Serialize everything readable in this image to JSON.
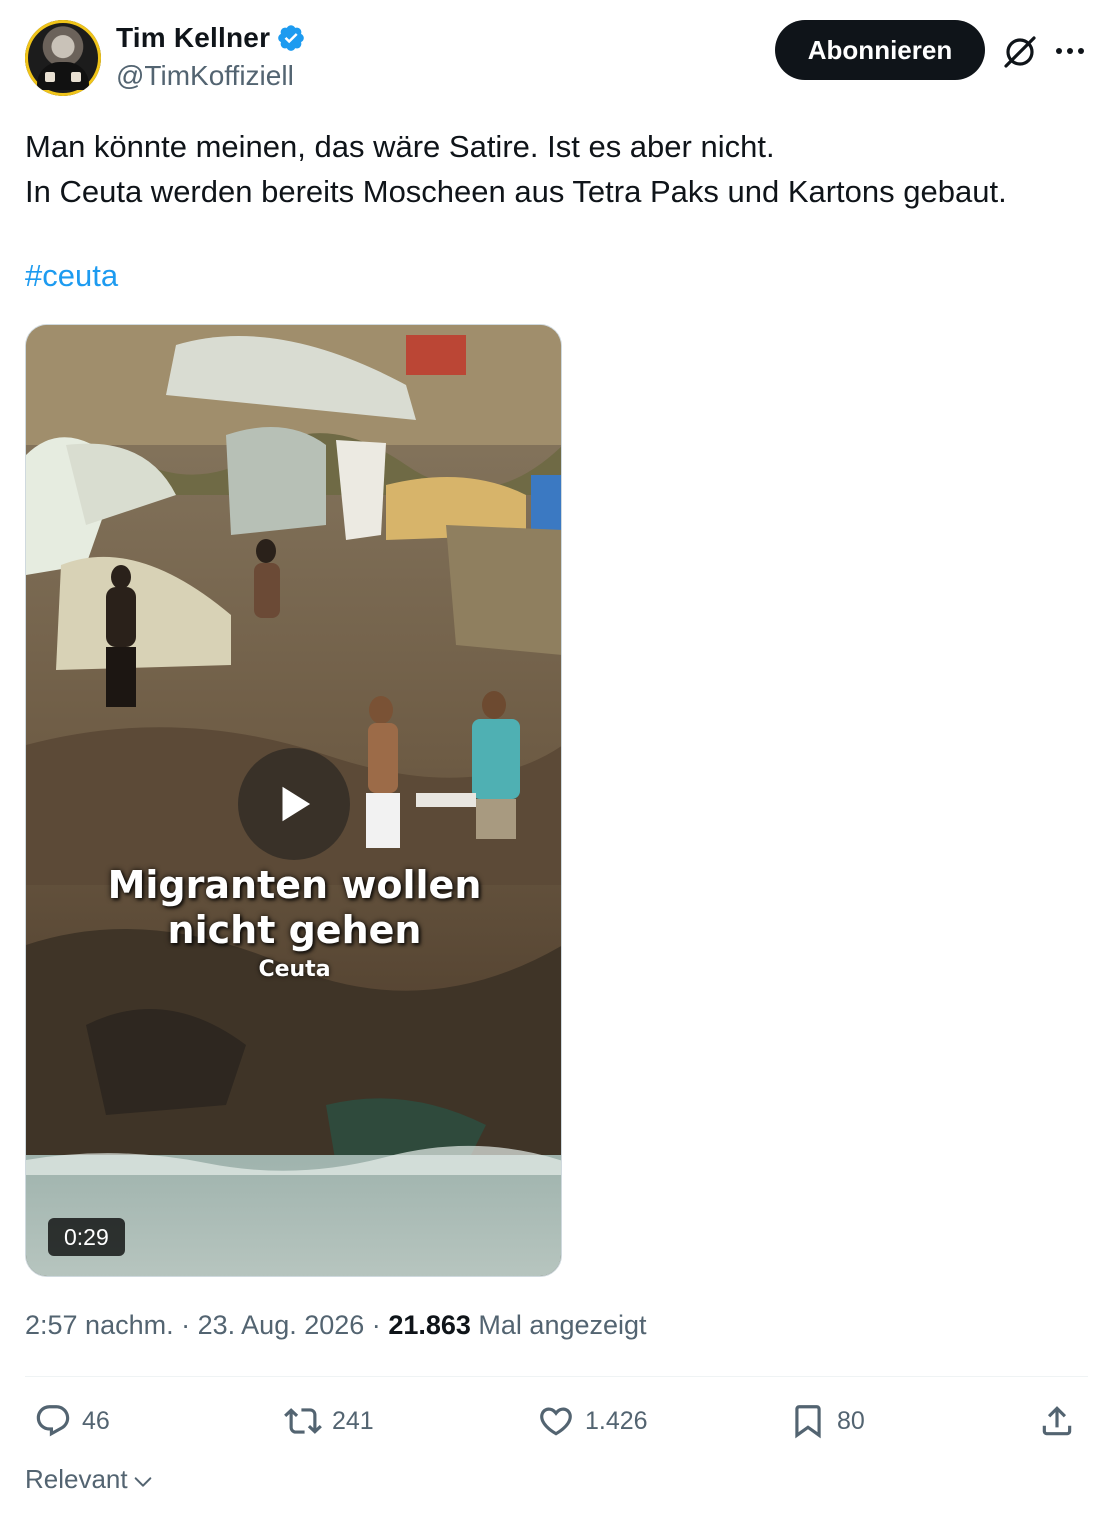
{
  "author": {
    "display_name": "Tim Kellner",
    "handle": "@TimKoffiziell",
    "verified": true
  },
  "header": {
    "follow_label": "Abonnieren",
    "grok_icon": "grok-icon",
    "more_icon": "more-icon"
  },
  "tweet": {
    "line1": "Man könnte meinen, das wäre Satire. Ist es aber nicht.",
    "line2": "In Ceuta werden bereits Moscheen aus Tetra Paks und Kartons gebaut.",
    "hashtag": "#ceuta"
  },
  "video": {
    "caption_line1": "Migranten wollen",
    "caption_line2": "nicht gehen",
    "caption_location": "Ceuta",
    "duration": "0:29"
  },
  "meta": {
    "time": "2:57 nachm.",
    "separator": "·",
    "date": "23. Aug. 2026",
    "views": "21.863",
    "views_label": "Mal angezeigt"
  },
  "actions": {
    "replies": "46",
    "retweets": "241",
    "likes": "1.426",
    "bookmarks": "80"
  },
  "sort": {
    "label": "Relevant"
  },
  "colors": {
    "accent": "#1d9bf0",
    "text": "#0f1419",
    "secondary": "#536471"
  }
}
